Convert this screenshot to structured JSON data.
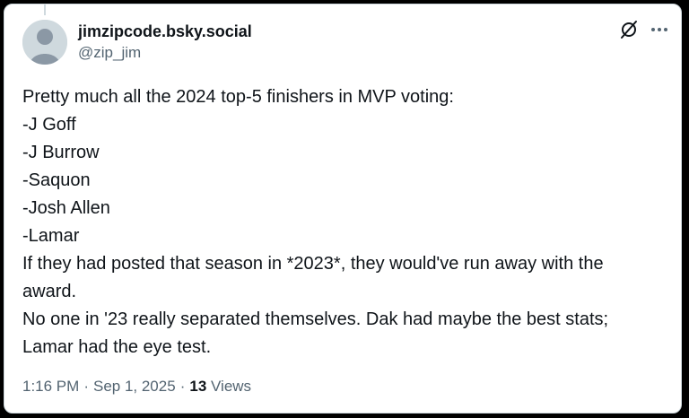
{
  "post": {
    "author": {
      "display_name": "jimzipcode.bsky.social",
      "handle": "@zip_jim"
    },
    "icons": {
      "grok": "grok-icon",
      "more": "more-options-icon"
    },
    "body_lines": [
      "Pretty much all the 2024 top-5 finishers in MVP voting:",
      "-J Goff",
      "-J Burrow",
      "-Saquon",
      "-Josh Allen",
      "-Lamar",
      "If they had posted that season in *2023*, they would've run away with the",
      "award.",
      "No one in '23 really separated themselves. Dak had maybe the best stats;",
      "Lamar had the eye test."
    ],
    "meta": {
      "time": "1:16 PM",
      "separator": "·",
      "date": "Sep 1, 2025",
      "views_count": "13",
      "views_label": "Views"
    }
  }
}
